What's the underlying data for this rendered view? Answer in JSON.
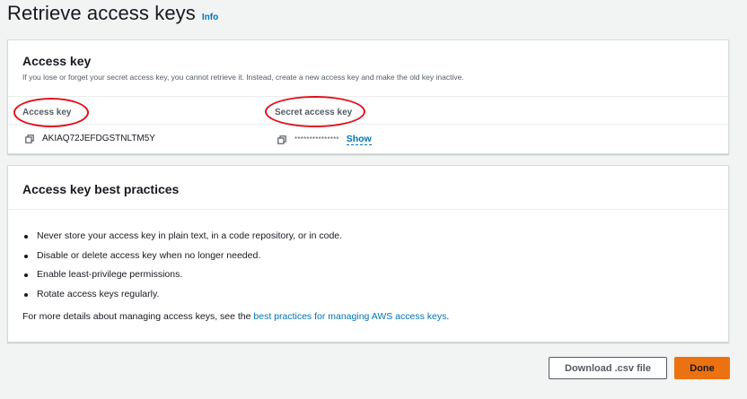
{
  "header": {
    "title": "Retrieve access keys",
    "info": "Info"
  },
  "access_key_panel": {
    "title": "Access key",
    "description": "If you lose or forget your secret access key, you cannot retrieve it. Instead, create a new access key and make the old key inactive.",
    "columns": [
      "Access key",
      "Secret access key"
    ],
    "access_key_value": "AKIAQ72JEFDGSTNLTM5Y",
    "secret_masked": "***************",
    "show_label": "Show",
    "annotation_color": "#e3101b"
  },
  "best_practices_panel": {
    "title": "Access key best practices",
    "items": [
      "Never store your access key in plain text, in a code repository, or in code.",
      "Disable or delete access key when no longer needed.",
      "Enable least-privilege permissions.",
      "Rotate access keys regularly."
    ],
    "more_prefix": "For more details about managing access keys, see the ",
    "more_link": "best practices for managing AWS access keys",
    "more_suffix": "."
  },
  "actions": {
    "download_label": "Download .csv file",
    "done_label": "Done"
  },
  "colors": {
    "link": "#0073bb",
    "primary_button": "#ec7211"
  }
}
